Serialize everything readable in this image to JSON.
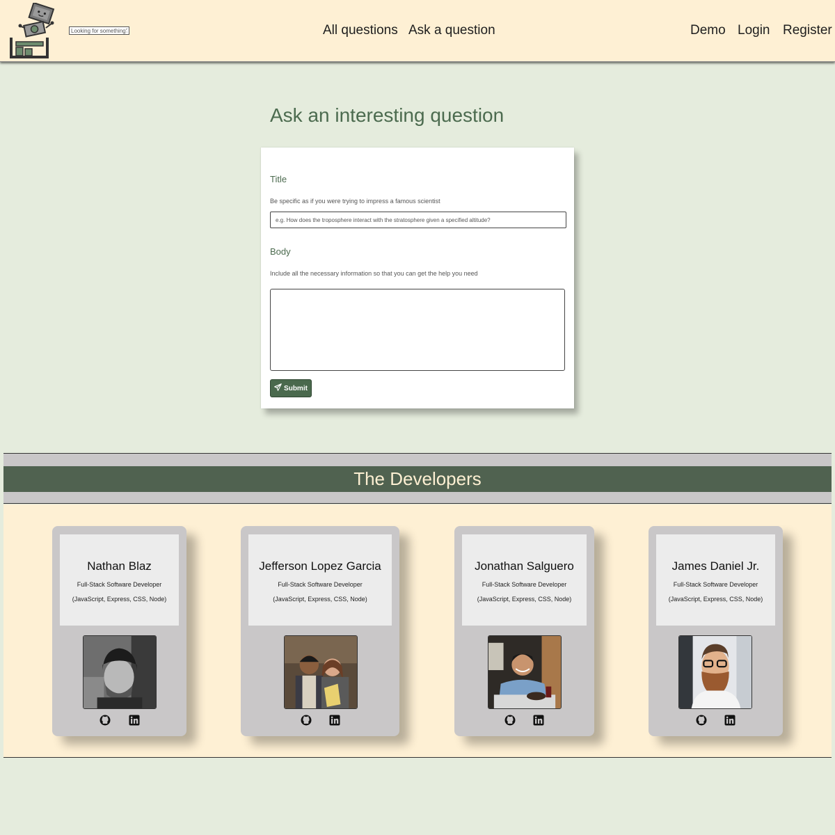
{
  "header": {
    "search_placeholder": "Looking for something?",
    "nav_center": [
      "All questions",
      "Ask a question"
    ],
    "nav_right": [
      "Demo",
      "Login",
      "Register"
    ]
  },
  "page": {
    "title": "Ask an interesting question"
  },
  "form": {
    "title_label": "Title",
    "title_hint": "Be specific as if you were trying to impress a famous scientist",
    "title_placeholder": "e.g. How does the troposphere interact with the stratosphere given a specified altitude?",
    "title_value": "",
    "body_label": "Body",
    "body_hint": "Include all the necessary information so that you can get the help you need",
    "body_value": "",
    "submit_label": "Submit",
    "submit_icon": "paper-plane-icon"
  },
  "developers": {
    "heading": "The Developers",
    "items": [
      {
        "name": "Nathan Blaz",
        "role": "Full-Stack Software Developer",
        "stack": "(JavaScript, Express, CSS, Node)"
      },
      {
        "name": "Jefferson Lopez Garcia",
        "role": "Full-Stack Software Developer",
        "stack": "(JavaScript, Express, CSS, Node)"
      },
      {
        "name": "Jonathan Salguero",
        "role": "Full-Stack Software Developer",
        "stack": "(JavaScript, Express, CSS, Node)"
      },
      {
        "name": "James Daniel Jr.",
        "role": "Full-Stack Software Developer",
        "stack": "(JavaScript, Express, CSS, Node)"
      }
    ],
    "social_icons": [
      "github-icon",
      "linkedin-icon"
    ]
  },
  "colors": {
    "page_bg": "#e5ecdd",
    "header_bg": "#fef0d4",
    "accent_green": "#4a694d",
    "dev_bar": "#506250",
    "card_gray": "#c9c7c8"
  }
}
